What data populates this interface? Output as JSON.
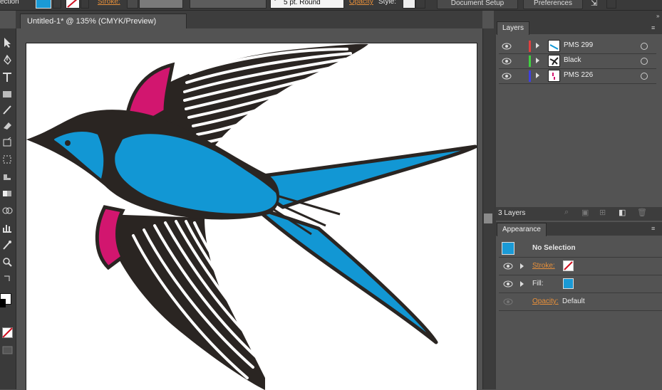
{
  "control_bar": {
    "selection_label": "ection",
    "stroke_label": "Stroke:",
    "brush_label": "5 pt. Round",
    "opacity_label": "Opacity",
    "style_label": "Style:",
    "document_setup": "Document Setup",
    "preferences": "Preferences"
  },
  "document": {
    "tab_title": "Untitled-1* @ 135% (CMYK/Preview)"
  },
  "layers_panel": {
    "title": "Layers",
    "layers": [
      {
        "name": "PMS 299",
        "color": "#e04040"
      },
      {
        "name": "Black",
        "color": "#40d040"
      },
      {
        "name": "PMS 226",
        "color": "#4040e0"
      }
    ],
    "count": "3 Layers"
  },
  "appearance_panel": {
    "title": "Appearance",
    "selection": "No Selection",
    "stroke_label": "Stroke:",
    "fill_label": "Fill:",
    "opacity_label": "Opacity:",
    "opacity_value": "Default",
    "fill_color": "#1a9ad6"
  },
  "colors": {
    "bird_blue": "#1297d4",
    "bird_magenta": "#d2166f",
    "bird_dark": "#2a2522"
  }
}
